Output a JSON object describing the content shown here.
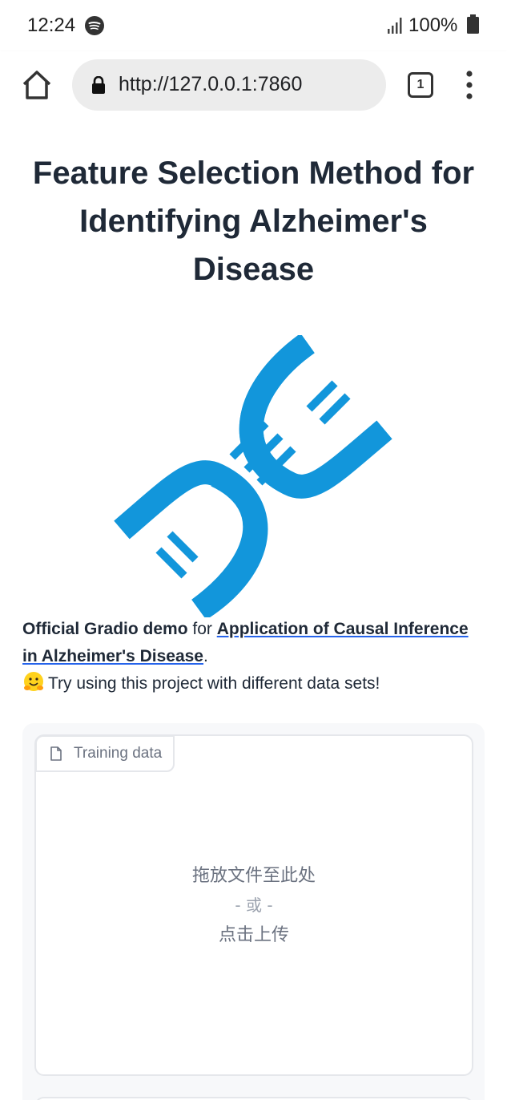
{
  "status_bar": {
    "time": "12:24",
    "battery": "100%",
    "icons": [
      "spotify-icon",
      "signal-icon",
      "battery-icon"
    ]
  },
  "browser": {
    "url": "http://127.0.0.1:7860",
    "tab_count": "1",
    "icons": [
      "home-icon",
      "lock-icon",
      "more-vert-icon"
    ]
  },
  "page": {
    "title": "Feature Selection Method for Identifying Alzheimer's Disease",
    "logo_icon": "dna-icon",
    "logo_color": "#1296db",
    "description": {
      "bold_lead": "Official Gradio demo",
      "for_text": " for ",
      "link_text": "Application of Causal Inference in Alzheimer's Disease",
      "period": ".",
      "hint": "Try using this project with different data sets!",
      "hint_icon": "hugging-face-icon"
    },
    "upload": {
      "label": "Training data",
      "label_icon": "file-icon",
      "drop_text": "拖放文件至此处",
      "or_text": "- 或 -",
      "click_text": "点击上传"
    }
  }
}
